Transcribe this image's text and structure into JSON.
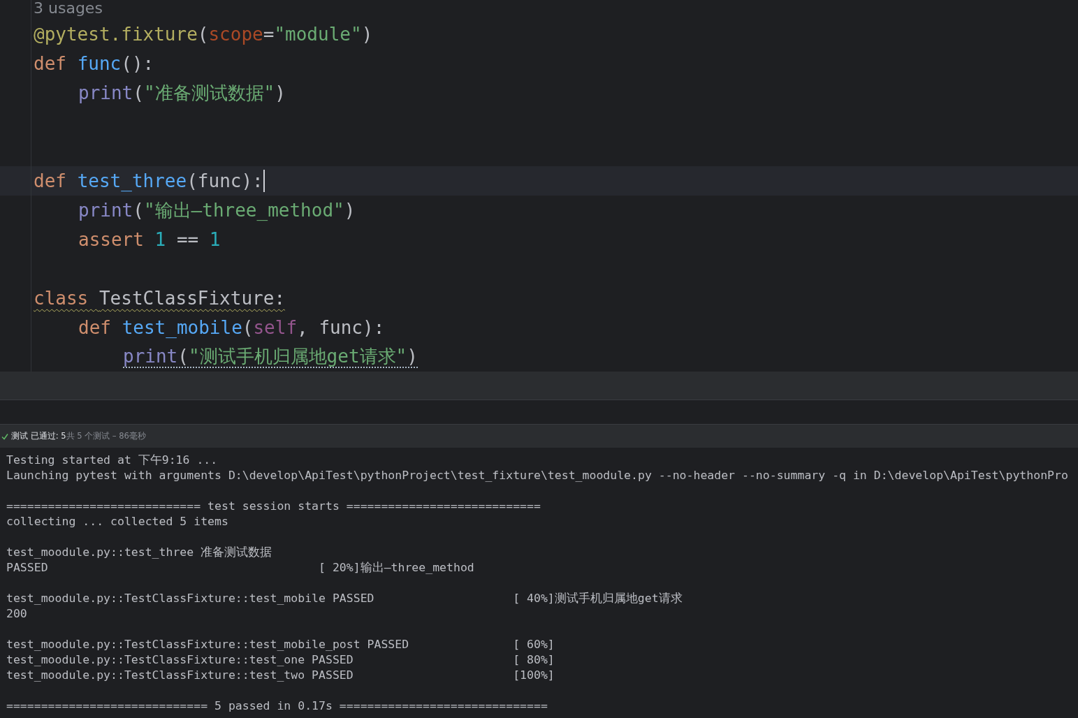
{
  "editor": {
    "usages": "3 usages",
    "lines": [
      {
        "kind": "code",
        "current": false,
        "caret": false,
        "warning": false,
        "typo": false,
        "tokens": [
          {
            "text": "@pytest.fixture",
            "kind": "decorator"
          },
          {
            "text": "(",
            "kind": "plain"
          },
          {
            "text": "scope",
            "kind": "kwarg"
          },
          {
            "text": "=",
            "kind": "plain"
          },
          {
            "text": "\"module\"",
            "kind": "string"
          },
          {
            "text": ")",
            "kind": "plain"
          }
        ]
      },
      {
        "kind": "code",
        "current": false,
        "caret": false,
        "warning": false,
        "typo": false,
        "tokens": [
          {
            "text": "def ",
            "kind": "keyword"
          },
          {
            "text": "func",
            "kind": "function"
          },
          {
            "text": "():",
            "kind": "plain"
          }
        ],
        "children": [
          {
            "kind": "code",
            "current": false,
            "caret": false,
            "warning": false,
            "typo": false,
            "tokens": [
              {
                "text": "print",
                "kind": "builtin"
              },
              {
                "text": "(",
                "kind": "plain"
              },
              {
                "text": "\"准备测试数据\"",
                "kind": "string"
              },
              {
                "text": ")",
                "kind": "plain"
              }
            ]
          }
        ]
      },
      {
        "kind": "blank",
        "current": false,
        "caret": false
      },
      {
        "kind": "blank",
        "current": false,
        "caret": false
      },
      {
        "kind": "code",
        "current": true,
        "caret": true,
        "warning": false,
        "typo": false,
        "tokens": [
          {
            "text": "def ",
            "kind": "keyword"
          },
          {
            "text": "test_three",
            "kind": "function"
          },
          {
            "text": "(func):",
            "kind": "plain"
          }
        ],
        "children": [
          {
            "kind": "code",
            "current": false,
            "caret": false,
            "warning": false,
            "typo": false,
            "tokens": [
              {
                "text": "print",
                "kind": "builtin"
              },
              {
                "text": "(",
                "kind": "plain"
              },
              {
                "text": "\"输出—three_method\"",
                "kind": "string"
              },
              {
                "text": ")",
                "kind": "plain"
              }
            ]
          },
          {
            "kind": "code",
            "current": false,
            "caret": false,
            "warning": false,
            "typo": false,
            "tokens": [
              {
                "text": "assert ",
                "kind": "keyword"
              },
              {
                "text": "1",
                "kind": "number"
              },
              {
                "text": " == ",
                "kind": "plain"
              },
              {
                "text": "1",
                "kind": "number"
              }
            ]
          }
        ]
      },
      {
        "kind": "blank",
        "current": false,
        "caret": false
      },
      {
        "kind": "code",
        "current": false,
        "caret": false,
        "warning": true,
        "typo": false,
        "tokens": [
          {
            "text": "class ",
            "kind": "keyword"
          },
          {
            "text": "TestClassFixture:",
            "kind": "plain"
          }
        ],
        "children": [
          {
            "kind": "code",
            "current": false,
            "caret": false,
            "warning": false,
            "typo": false,
            "tokens": [
              {
                "text": "def ",
                "kind": "keyword"
              },
              {
                "text": "test_mobile",
                "kind": "function"
              },
              {
                "text": "(",
                "kind": "plain"
              },
              {
                "text": "self",
                "kind": "self"
              },
              {
                "text": ", func):",
                "kind": "plain"
              }
            ],
            "children": [
              {
                "kind": "code",
                "current": false,
                "caret": false,
                "warning": false,
                "typo": true,
                "tokens": [
                  {
                    "text": "print",
                    "kind": "builtin"
                  },
                  {
                    "text": "(",
                    "kind": "plain"
                  },
                  {
                    "text": "\"测试手机归属地get请求\"",
                    "kind": "string"
                  },
                  {
                    "text": ")",
                    "kind": "plain"
                  }
                ]
              }
            ]
          }
        ]
      }
    ]
  },
  "test_status": {
    "passed": true,
    "summary": "测试 已通过: 5",
    "detail": "共 5 个测试 – 86毫秒"
  },
  "console": [
    [
      "Testing started at 下午9:16 ...",
      "Launching pytest with arguments D:\\develop\\ApiTest\\pythonProject\\test_fixture\\test_moodule.py --no-header --no-summary -q in D:\\develop\\ApiTest\\pythonPro"
    ],
    [
      "============================ test session starts ============================",
      "collecting ... collected 5 items"
    ],
    [
      "test_moodule.py::test_three 准备测试数据",
      "PASSED                                       [ 20%]输出—three_method"
    ],
    [
      "test_moodule.py::TestClassFixture::test_mobile PASSED                    [ 40%]测试手机归属地get请求",
      "200"
    ],
    [
      "test_moodule.py::TestClassFixture::test_mobile_post PASSED               [ 60%]",
      "test_moodule.py::TestClassFixture::test_one PASSED                       [ 80%]",
      "test_moodule.py::TestClassFixture::test_two PASSED                       [100%]"
    ],
    [
      "============================= 5 passed in 0.17s =============================="
    ]
  ]
}
